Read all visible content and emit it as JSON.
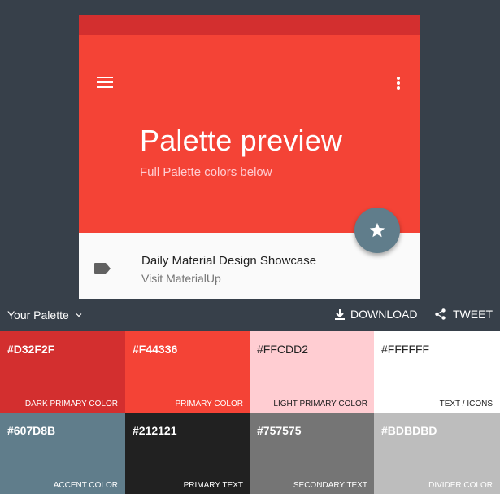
{
  "preview": {
    "title": "Palette preview",
    "subtitle": "Full Palette colors below",
    "list_primary": "Daily Material Design Showcase",
    "list_secondary": "Visit MaterialUp",
    "icons": [
      "menu-icon",
      "more-vert-icon",
      "star-icon",
      "label-tag-icon"
    ]
  },
  "toolbar": {
    "palette_label": "Your Palette",
    "download_label": "DOWNLOAD",
    "tweet_label": "TWEET"
  },
  "swatches": [
    {
      "hex": "#D32F2F",
      "name": "DARK PRIMARY COLOR",
      "color": "#d32f2f",
      "text": "light"
    },
    {
      "hex": "#F44336",
      "name": "PRIMARY COLOR",
      "color": "#f44336",
      "text": "light"
    },
    {
      "hex": "#FFCDD2",
      "name": "LIGHT PRIMARY COLOR",
      "color": "#ffcdd2",
      "text": "dark"
    },
    {
      "hex": "#FFFFFF",
      "name": "TEXT / ICONS",
      "color": "#ffffff",
      "text": "dark"
    },
    {
      "hex": "#607D8B",
      "name": "ACCENT COLOR",
      "color": "#607d8b",
      "text": "light"
    },
    {
      "hex": "#212121",
      "name": "PRIMARY TEXT",
      "color": "#212121",
      "text": "light"
    },
    {
      "hex": "#757575",
      "name": "SECONDARY TEXT",
      "color": "#757575",
      "text": "light"
    },
    {
      "hex": "#BDBDBD",
      "name": "DIVIDER COLOR",
      "color": "#bdbdbd",
      "text": "light"
    }
  ]
}
